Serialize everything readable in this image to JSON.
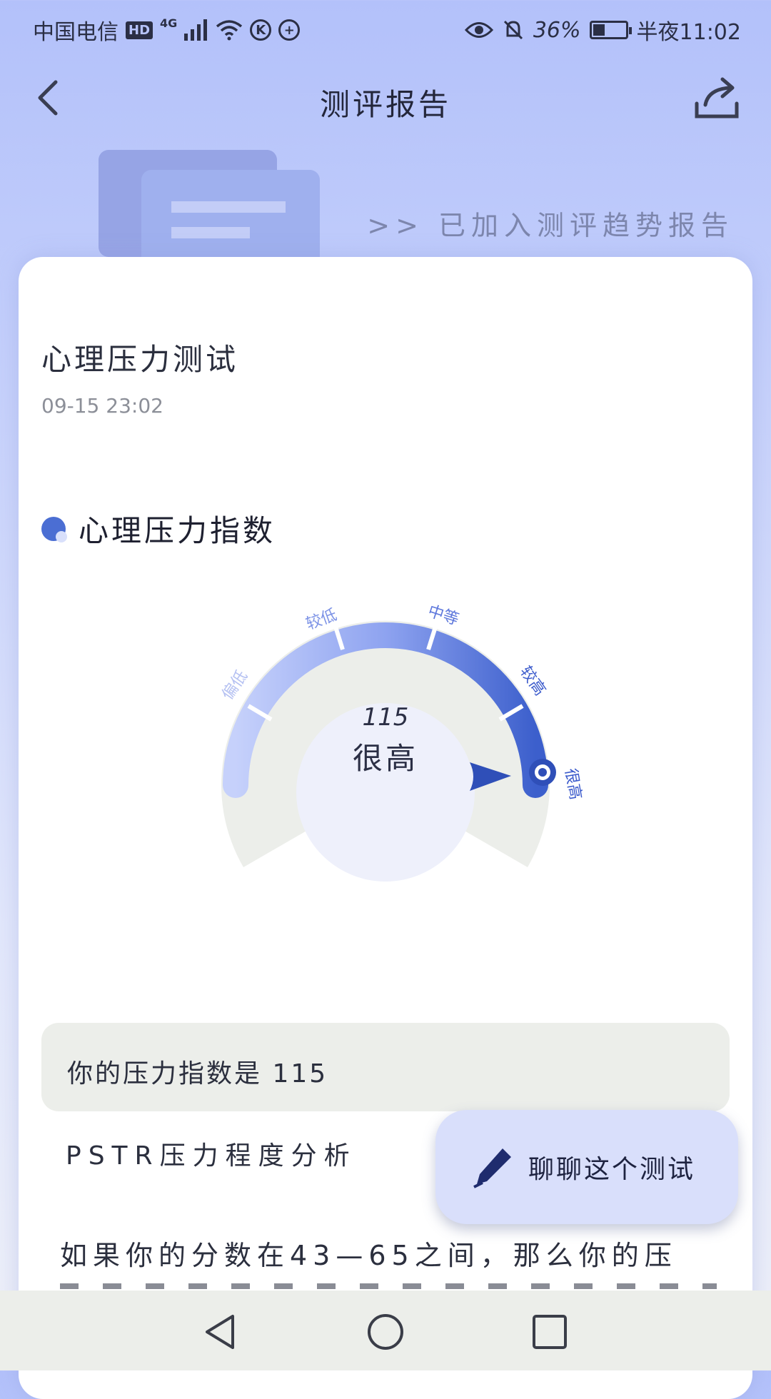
{
  "status_bar": {
    "carrier": "中国电信",
    "hd": "HD",
    "network": "4G",
    "battery": "36%",
    "time": "半夜11:02",
    "icons": [
      "hd-icon",
      "signal-icon",
      "wifi-icon",
      "k-icon",
      "plus-circle-icon",
      "eye-icon",
      "bell-off-icon",
      "battery-icon"
    ]
  },
  "header": {
    "title": "测评报告",
    "back_icon": "chevron-left-icon",
    "share_icon": "share-icon"
  },
  "trend_notice": ">> 已加入测评趋势报告",
  "report": {
    "test_name": "心理压力测试",
    "test_time": "09-15 23:02",
    "section_title": "心理压力指数",
    "gauge": {
      "score": "115",
      "level": "很高",
      "segments": [
        "偏低",
        "较低",
        "中等",
        "较高",
        "很高"
      ],
      "current_segment": 4
    },
    "result_text": "你的压力指数是 115",
    "analysis_title": "PSTR压力程度分析",
    "body_text": "如果你的分数在43—65之间，那么你的压"
  },
  "chat_button": {
    "label": "聊聊这个测试",
    "icon": "pen-icon"
  },
  "colors": {
    "accent": "#4b6ed3",
    "header_bg": "#b3c1fa",
    "card_bg": "#ffffff",
    "chat_bg": "#d9dffb"
  },
  "navbar": {
    "icons": [
      "nav-back-icon",
      "nav-home-icon",
      "nav-recent-icon"
    ]
  }
}
